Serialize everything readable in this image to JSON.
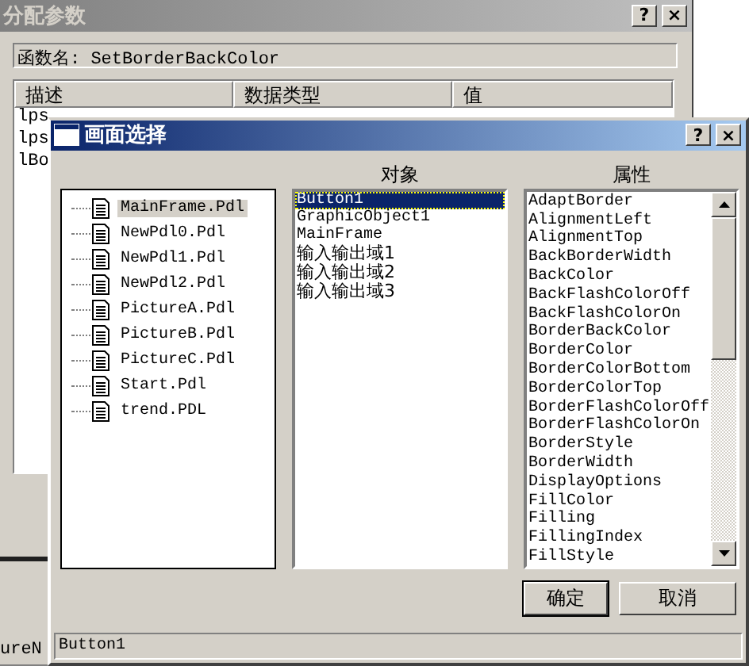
{
  "background_dialog": {
    "title": "分配参数",
    "title_buttons": [
      "?",
      "×"
    ],
    "function_label": "函数名: SetBorderBackColor",
    "table": {
      "columns": [
        "描述",
        "数据类型",
        "值"
      ],
      "rows": [
        [
          "lps"
        ],
        [
          "lps"
        ],
        [
          "lBo"
        ]
      ]
    },
    "partial_field": "ureN"
  },
  "dialog": {
    "title": "画面选择",
    "title_buttons": [
      "?",
      "×"
    ],
    "files": [
      {
        "name": "MainFrame.Pdl",
        "selected": true
      },
      {
        "name": "NewPdl0.Pdl",
        "selected": false
      },
      {
        "name": "NewPdl1.Pdl",
        "selected": false
      },
      {
        "name": "NewPdl2.Pdl",
        "selected": false
      },
      {
        "name": "PictureA.Pdl",
        "selected": false
      },
      {
        "name": "PictureB.Pdl",
        "selected": false
      },
      {
        "name": "PictureC.Pdl",
        "selected": false
      },
      {
        "name": "Start.Pdl",
        "selected": false
      },
      {
        "name": "trend.PDL",
        "selected": false
      }
    ],
    "objects_label": "对象",
    "objects": [
      {
        "label": "Button1",
        "selected": true
      },
      {
        "label": "GraphicObject1",
        "selected": false
      },
      {
        "label": "MainFrame",
        "selected": false
      },
      {
        "label": "输入输出域1",
        "selected": false
      },
      {
        "label": "输入输出域2",
        "selected": false
      },
      {
        "label": "输入输出域3",
        "selected": false
      }
    ],
    "properties_label": "属性",
    "properties": [
      "AdaptBorder",
      "AlignmentLeft",
      "AlignmentTop",
      "BackBorderWidth",
      "BackColor",
      "BackFlashColorOff",
      "BackFlashColorOn",
      "BorderBackColor",
      "BorderColor",
      "BorderColorBottom",
      "BorderColorTop",
      "BorderFlashColorOff",
      "BorderFlashColorOn",
      "BorderStyle",
      "BorderWidth",
      "DisplayOptions",
      "FillColor",
      "Filling",
      "FillingIndex",
      "FillStyle"
    ],
    "buttons": [
      "确定",
      "取消"
    ],
    "status_bar": "Button1"
  }
}
